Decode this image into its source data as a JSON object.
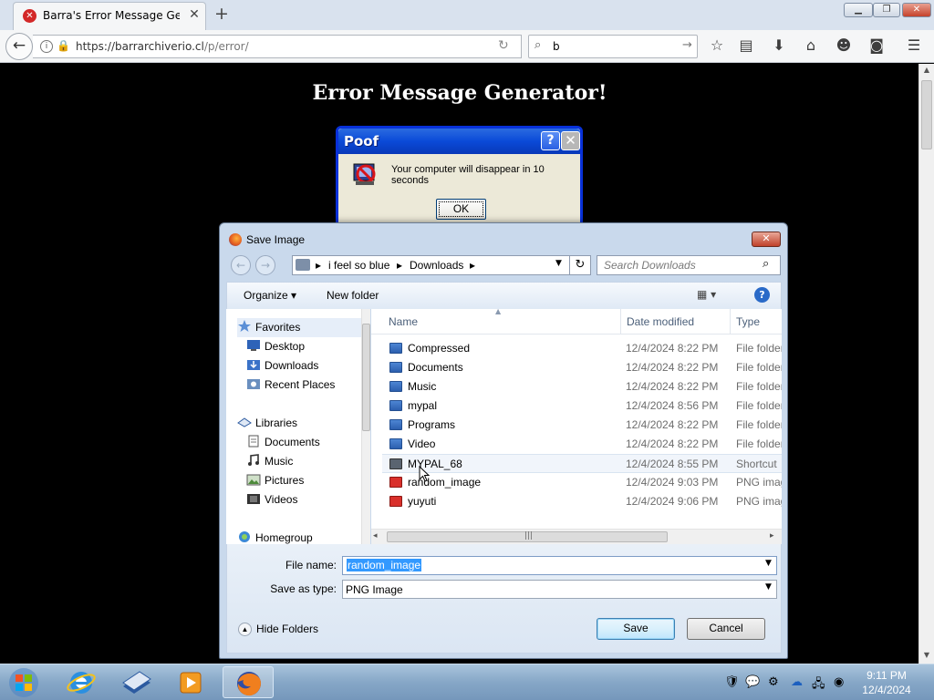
{
  "browser": {
    "tab_title": "Barra's Error Message Gene...",
    "tab_close_glyph": "✕",
    "new_tab_glyph": "+",
    "url_host": "https://barrarchiverio.cl",
    "url_path": "/p/error/",
    "search_value": "b",
    "window_buttons": {
      "minimize": "▁",
      "maximize": "❐",
      "close": "✕"
    }
  },
  "page": {
    "heading": "Error Message Generator!"
  },
  "xp_dialog": {
    "title": "Poof",
    "help_glyph": "?",
    "close_glyph": "✕",
    "message": "Your computer will disappear in 10 seconds",
    "ok_label": "OK",
    "colors": {
      "titlebar": "#0a4ad8",
      "body": "#ece9d8"
    }
  },
  "save_dialog": {
    "title": "Save Image",
    "breadcrumbs": [
      "i feel so blue",
      "Downloads"
    ],
    "search_placeholder": "Search Downloads",
    "organize_label": "Organize ▾",
    "new_folder_label": "New folder",
    "views_label": "▦ ▾",
    "help_glyph": "?",
    "nav": [
      {
        "label": "Favorites",
        "icon": "star-icon",
        "group": true
      },
      {
        "label": "Desktop",
        "icon": "desktop-icon"
      },
      {
        "label": "Downloads",
        "icon": "downloads-icon"
      },
      {
        "label": "Recent Places",
        "icon": "recent-places-icon"
      },
      {
        "label": "Libraries",
        "icon": "libraries-icon",
        "group": true
      },
      {
        "label": "Documents",
        "icon": "documents-icon"
      },
      {
        "label": "Music",
        "icon": "music-icon"
      },
      {
        "label": "Pictures",
        "icon": "pictures-icon"
      },
      {
        "label": "Videos",
        "icon": "videos-icon"
      },
      {
        "label": "Homegroup",
        "icon": "homegroup-icon",
        "group": true
      }
    ],
    "columns": {
      "name": "Name",
      "date": "Date modified",
      "type": "Type"
    },
    "files": [
      {
        "name": "Compressed",
        "date": "12/4/2024 8:22 PM",
        "type": "File folder",
        "icon": "folder-icon"
      },
      {
        "name": "Documents",
        "date": "12/4/2024 8:22 PM",
        "type": "File folder",
        "icon": "folder-icon"
      },
      {
        "name": "Music",
        "date": "12/4/2024 8:22 PM",
        "type": "File folder",
        "icon": "folder-icon"
      },
      {
        "name": "mypal",
        "date": "12/4/2024 8:56 PM",
        "type": "File folder",
        "icon": "folder-icon"
      },
      {
        "name": "Programs",
        "date": "12/4/2024 8:22 PM",
        "type": "File folder",
        "icon": "folder-icon"
      },
      {
        "name": "Video",
        "date": "12/4/2024 8:22 PM",
        "type": "File folder",
        "icon": "folder-icon"
      },
      {
        "name": "MYPAL_68",
        "date": "12/4/2024 8:55 PM",
        "type": "Shortcut",
        "icon": "shortcut-icon"
      },
      {
        "name": "random_image",
        "date": "12/4/2024 9:03 PM",
        "type": "PNG image",
        "icon": "png-file-icon"
      },
      {
        "name": "yuyuti",
        "date": "12/4/2024 9:06 PM",
        "type": "PNG image",
        "icon": "png-file-icon"
      }
    ],
    "file_name_label": "File name:",
    "file_name_value": "random_image",
    "save_as_label": "Save as type:",
    "save_as_value": "PNG Image",
    "hide_folders_label": "Hide Folders",
    "save_label": "Save",
    "cancel_label": "Cancel"
  },
  "taskbar": {
    "time": "9:11 PM",
    "date": "12/4/2024"
  }
}
